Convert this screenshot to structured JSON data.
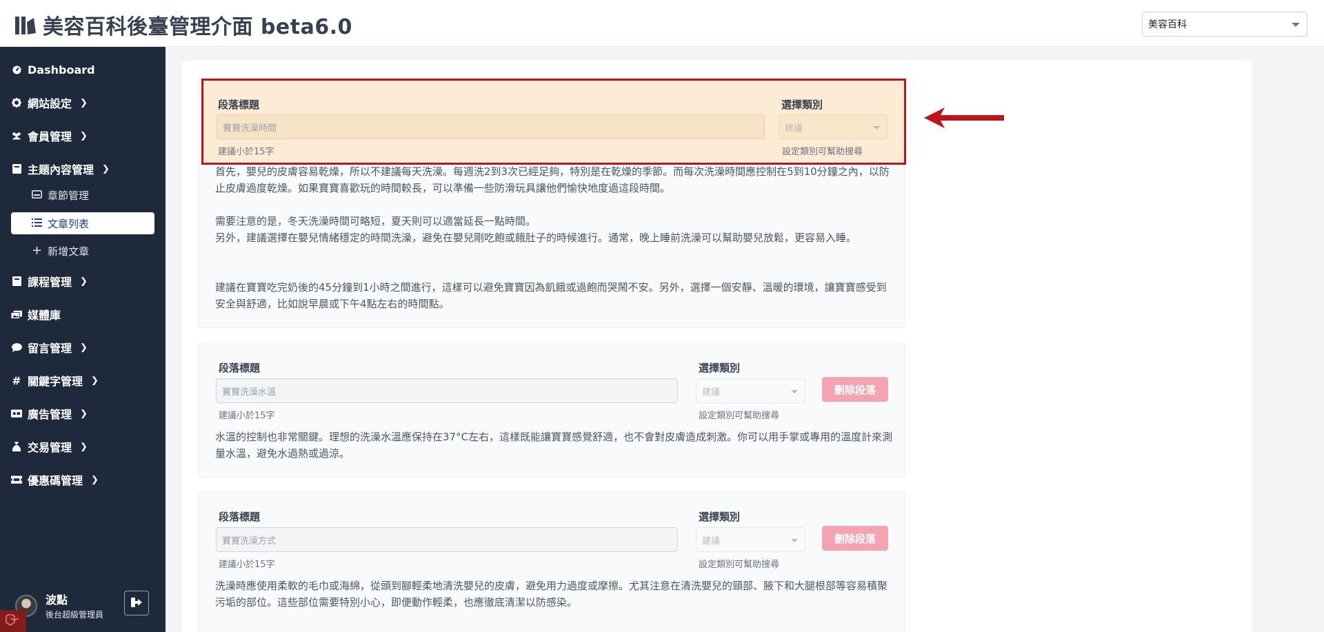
{
  "header": {
    "title": "美容百科後臺管理介面 beta6.0",
    "site_select_value": "美容百科"
  },
  "sidebar": {
    "items": [
      {
        "label": "Dashboard",
        "icon": "gauge-icon"
      },
      {
        "label": "網站設定",
        "icon": "gear-icon"
      },
      {
        "label": "會員管理",
        "icon": "users-icon"
      },
      {
        "label": "主題內容管理",
        "icon": "book-icon"
      },
      {
        "label": "課程管理",
        "icon": "book-icon"
      },
      {
        "label": "媒體庫",
        "icon": "images-icon"
      },
      {
        "label": "留言管理",
        "icon": "comment-icon"
      },
      {
        "label": "關鍵字管理",
        "icon": "hash-icon"
      },
      {
        "label": "廣告管理",
        "icon": "ad-icon"
      },
      {
        "label": "交易管理",
        "icon": "money-bag-icon"
      },
      {
        "label": "優惠碼管理",
        "icon": "ticket-icon"
      }
    ],
    "subitems": [
      {
        "label": "章節管理",
        "icon": "inbox-icon"
      },
      {
        "label": "文章列表",
        "icon": "list-icon"
      },
      {
        "label": "新增文章",
        "icon": "plus-icon"
      }
    ],
    "user": {
      "name": "波點",
      "role": "後台超級管理員"
    }
  },
  "form": {
    "title_label": "段落標題",
    "category_label": "選擇類別",
    "title_hint": "建議小於15字",
    "category_hint": "設定類別可幫助搜尋",
    "category_placeholder": "建議",
    "delete_label": "刪除段落"
  },
  "sections": [
    {
      "title_value": "寶寶洗澡時間",
      "paragraphs": [
        "首先，嬰兒的皮膚容易乾燥，所以不建議每天洗澡。每週洗2到3次已經足夠，特別是在乾燥的季節。而每次洗澡時間應控制在5到10分鐘之內，以防止皮膚過度乾燥。如果寶寶喜歡玩的時間較長，可以準備一些防滑玩具讓他們愉快地度過這段時間。",
        "需要注意的是，冬天洗澡時間可略短，夏天則可以適當延長一點時間。",
        "另外，建議選擇在嬰兒情緒穩定的時間洗澡，避免在嬰兒剛吃飽或餓肚子的時候進行。通常，晚上睡前洗澡可以幫助嬰兒放鬆，更容易入睡。",
        "建議在寶寶吃完奶後的45分鐘到1小時之間進行，這樣可以避免寶寶因為飢餓或過飽而哭鬧不安。另外，選擇一個安靜、溫暖的環境，讓寶寶感受到安全與舒適，比如說早晨或下午4點左右的時間點。"
      ]
    },
    {
      "title_value": "寶寶洗澡水溫",
      "paragraphs": [
        "水溫的控制也非常關鍵。理想的洗澡水溫應保持在37°C左右，這樣既能讓寶寶感覺舒適，也不會對皮膚造成刺激。你可以用手掌或專用的溫度計來測量水溫，避免水過熱或過涼。"
      ]
    },
    {
      "title_value": "寶寶洗澡方式",
      "paragraphs": [
        "洗澡時應使用柔軟的毛巾或海綿，從頭到腳輕柔地清洗嬰兒的皮膚，避免用力過度或摩擦。尤其注意在清洗嬰兒的頸部、腋下和大腿根部等容易積聚污垢的部位。這些部位需要特別小心，即便動作輕柔，也應徹底清潔以防感染。"
      ]
    }
  ]
}
